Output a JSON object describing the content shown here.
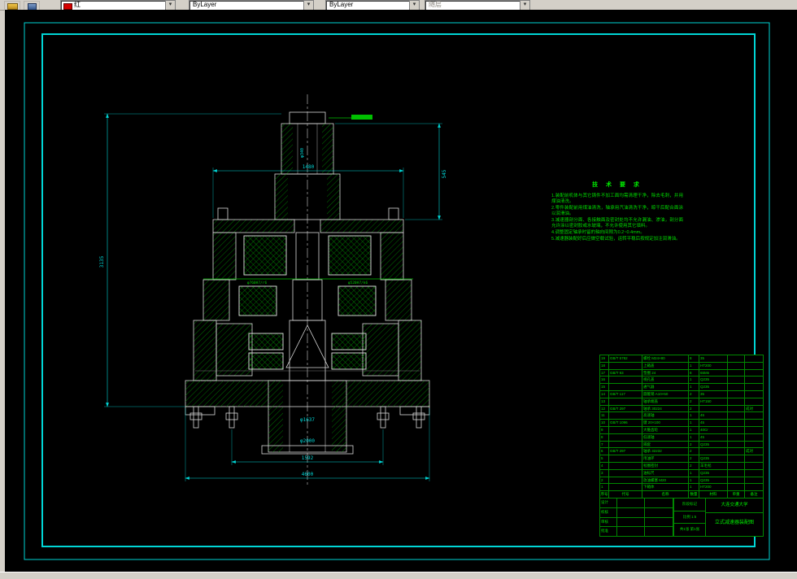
{
  "toolbar": {
    "color_label": "红",
    "linetype": "ByLayer",
    "lineweight": "ByLayer",
    "plot_style": "随层"
  },
  "drawing": {
    "dims": {
      "left_height": "3135",
      "right_height": "545",
      "top_width": "1480",
      "shaft_dia": "φ340",
      "bore_dia": "φ1637",
      "hub_dia": "φ2000",
      "bolt_span": "1592",
      "base_width": "4600"
    },
    "fits": {
      "f1": "φ760H7/r6",
      "f2": "φ520H7/k6"
    }
  },
  "tech": {
    "title": "技 术 要 求",
    "items": [
      "1.装配前机体与其它铸件不加工面均需清理干净，除去毛刺，并用煤油清洗。",
      "2.零件装配前用煤油清洗，轴承用汽油清洗干净，晾干后配合面涂以润滑油。",
      "3.减速器剖分面、各接触面及密封处均不允许漏油、渗油，剖分面允许涂以密封胶或水玻璃，不允许使用其它填料。",
      "4.调整固定轴承时留的轴向间隙为0.2~0.4mm。",
      "5.减速器装配好后应做空载试验，运转平稳后按规定加注润滑油。"
    ]
  },
  "parts": {
    "headers": [
      "序号",
      "代号",
      "名称",
      "数量",
      "材料",
      "单重",
      "备注"
    ],
    "rows": [
      [
        "19",
        "GB/T 5782",
        "螺栓 M24×80",
        "8",
        "35",
        "",
        ""
      ],
      [
        "18",
        "",
        "上箱盖",
        "1",
        "HT200",
        "",
        ""
      ],
      [
        "17",
        "GB/T 93",
        "垫圈 24",
        "8",
        "65Mn",
        "",
        ""
      ],
      [
        "16",
        "",
        "视孔盖",
        "1",
        "Q235",
        "",
        ""
      ],
      [
        "15",
        "",
        "通气器",
        "1",
        "Q235",
        "",
        ""
      ],
      [
        "14",
        "GB/T 117",
        "圆锥销 A10×50",
        "2",
        "35",
        "",
        ""
      ],
      [
        "13",
        "",
        "轴承端盖",
        "2",
        "HT150",
        "",
        ""
      ],
      [
        "12",
        "GB/T 297",
        "轴承 30224",
        "2",
        "",
        "",
        "成对"
      ],
      [
        "11",
        "",
        "高速轴",
        "1",
        "45",
        "",
        ""
      ],
      [
        "10",
        "GB/T 1096",
        "键 20×100",
        "1",
        "45",
        "",
        ""
      ],
      [
        "9",
        "",
        "大锥齿轮",
        "1",
        "40Cr",
        "",
        ""
      ],
      [
        "8",
        "",
        "低速轴",
        "1",
        "45",
        "",
        ""
      ],
      [
        "7",
        "",
        "隔套",
        "2",
        "Q235",
        "",
        ""
      ],
      [
        "6",
        "GB/T 297",
        "轴承 32232",
        "2",
        "",
        "",
        "成对"
      ],
      [
        "5",
        "",
        "甩油环",
        "2",
        "Q235",
        "",
        ""
      ],
      [
        "4",
        "",
        "毡圈密封",
        "2",
        "羊毛毡",
        "",
        ""
      ],
      [
        "3",
        "",
        "油标尺",
        "1",
        "Q235",
        "",
        ""
      ],
      [
        "2",
        "",
        "放油螺塞 M20",
        "1",
        "Q235",
        "",
        ""
      ],
      [
        "1",
        "",
        "下箱体",
        "1",
        "HT200",
        "",
        ""
      ]
    ]
  },
  "title_block": {
    "school": "大连交通大学",
    "title": "立式减速器装配图",
    "roles": [
      "设计",
      "校核",
      "审核",
      "批准"
    ],
    "stage_label": "阶段标记",
    "scale_text": "比例 1:5",
    "sheet_text": "共1张 第1张"
  }
}
